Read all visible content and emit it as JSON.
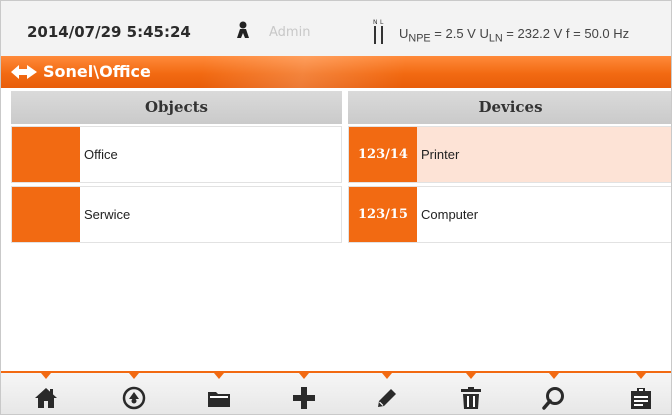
{
  "status": {
    "datetime": "2014/07/29 5:45:24",
    "user": "Admin",
    "readings_html": "U<sub>NPE</sub> = 2.5 V U<sub>LN</sub> = 232.2 V f = 50.0 Hz",
    "readings": "UNPE = 2.5 V ULN = 232.2 V f = 50.0 Hz",
    "plug_label": "N L"
  },
  "app": {
    "title": "Sonel\\Office"
  },
  "columns": {
    "objects": "Objects",
    "devices": "Devices"
  },
  "objects": [
    {
      "label": "Office"
    },
    {
      "label": "Serwice"
    }
  ],
  "devices": [
    {
      "code": "123/14",
      "label": "Printer",
      "selected": true
    },
    {
      "code": "123/15",
      "label": "Computer",
      "selected": false
    }
  ],
  "colors": {
    "accent": "#f26a12",
    "selected_row": "#fde3d6",
    "header_bg": "#cacaca"
  },
  "toolbar": [
    {
      "icon": "home-icon"
    },
    {
      "icon": "up-circle-icon"
    },
    {
      "icon": "folder-icon"
    },
    {
      "icon": "plus-icon"
    },
    {
      "icon": "pencil-icon"
    },
    {
      "icon": "trash-icon"
    },
    {
      "icon": "search-icon"
    },
    {
      "icon": "clipboard-icon"
    }
  ]
}
